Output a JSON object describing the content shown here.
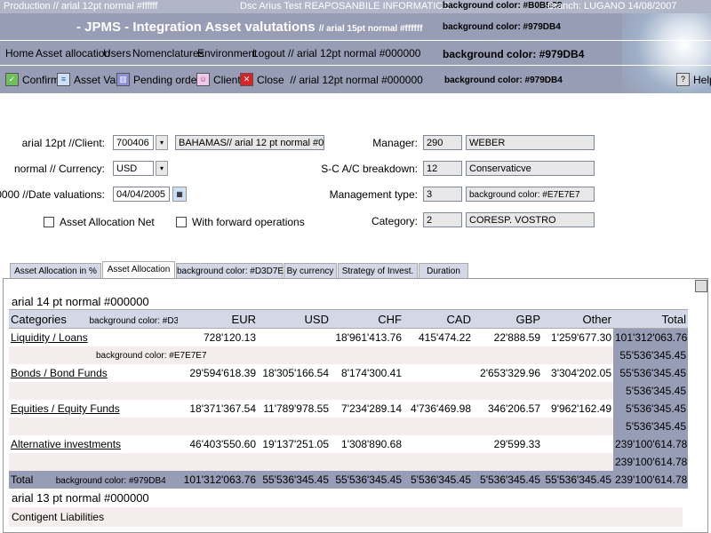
{
  "top": {
    "left": "Production // arial 12pt normal #ffffff",
    "center": "Dsc Arius Test REAPOSANBILE INFORMATICO",
    "bg": "background color: #B0B5C8",
    "branch": "Branch: LUGANO 14/08/2007"
  },
  "header": {
    "title": "- JPMS - Integration Asset valutations",
    "title_note": "// arial 15pt normal #ffffff",
    "bg_note1": "background color: #979DB4",
    "bg_note2": "background color: #979DB4",
    "bg_note3": "background color: #979DB4"
  },
  "menu": [
    "Home",
    "Asset allocation",
    "Users",
    "Nomenclatures",
    "Environment",
    "Logout // arial 12pt normal #000000"
  ],
  "toolbar": {
    "confirm": "Confirm",
    "asset_val": "Asset Val.",
    "pending": "Pending orders",
    "client": "Client",
    "close": "Close",
    "close_note": "// arial 12pt normal #000000",
    "help": "Help"
  },
  "form": {
    "client_label": "arial 12pt //Client:",
    "client_value": "700406",
    "client_desc": "BAHAMAS// arial 12 pt normal #000000",
    "currency_label": "normal // Currency:",
    "currency_value": "USD",
    "date_label": "#000000 //Date valuations:",
    "date_value": "04/04/2005",
    "manager_label": "Manager:",
    "manager_code": "290",
    "manager_name": "WEBER",
    "breakdown_label": "S-C A/C breakdown:",
    "breakdown_code": "12",
    "breakdown_name": "Conservaticve",
    "mgmt_label": "Management type:",
    "mgmt_code": "3",
    "mgmt_name": "background color: #E7E7E7",
    "category_label": "Category:",
    "category_code": "2",
    "category_name": "CORESP. VOSTRO",
    "chk_net": "Asset Allocation Net",
    "chk_forward": "With forward operations"
  },
  "tabs": [
    "Asset Allocation in %",
    "Asset Allocation",
    "background color: #D3D7E6",
    "By currency",
    "Strategy of Invest.",
    "Duration"
  ],
  "section_title": "arial 14 pt normal #000000",
  "table": {
    "headers": [
      "Categories",
      "EUR",
      "USD",
      "CHF",
      "CAD",
      "GBP",
      "Other",
      "Total"
    ],
    "header_note": "background color: #D3D7E6",
    "rows": [
      {
        "cat": "Liquidity / Loans",
        "eur": "728'120.13",
        "usd": "",
        "chf": "18'961'413.76",
        "cad": "415'474.22",
        "gbp": "22'888.59",
        "other": "1'259'677.30",
        "total": "101'312'063.76"
      },
      {
        "cat": "",
        "note": "background color: #E7E7E7",
        "total": "55'536'345.45"
      },
      {
        "cat": "Bonds / Bond Funds",
        "eur": "29'594'618.39",
        "usd": "18'305'166.54",
        "chf": "8'174'300.41",
        "cad": "",
        "gbp": "2'653'329.96",
        "other": "3'304'202.05",
        "total": "55'536'345.45"
      },
      {
        "cat": "",
        "total": "5'536'345.45"
      },
      {
        "cat": "Equities / Equity Funds",
        "eur": "18'371'367.54",
        "usd": "11'789'978.55",
        "chf": "7'234'289.14",
        "cad": "4'736'469.98",
        "gbp": "346'206.57",
        "other": "9'962'162.49",
        "total": "5'536'345.45"
      },
      {
        "cat": "",
        "total": "5'536'345.45"
      },
      {
        "cat": "Alternative investments",
        "eur": "46'403'550.60",
        "usd": "19'137'251.05",
        "chf": "1'308'890.68",
        "cad": "",
        "gbp": "29'599.33",
        "other": "",
        "total": "239'100'614.78"
      },
      {
        "cat": "",
        "total": "239'100'614.78"
      }
    ],
    "total_row": {
      "label": "Total",
      "note": "background color: #979DB4",
      "eur": "101'312'063.76",
      "usd": "55'536'345.45",
      "chf": "55'536'345.45",
      "cad": "5'536'345.45",
      "gbp": "5'536'345.45",
      "other": "55'536'345.45",
      "total": "239'100'614.78"
    }
  },
  "footer": {
    "note": "arial 13 pt normal #000000",
    "contingent": "Contigent Liabilities"
  }
}
